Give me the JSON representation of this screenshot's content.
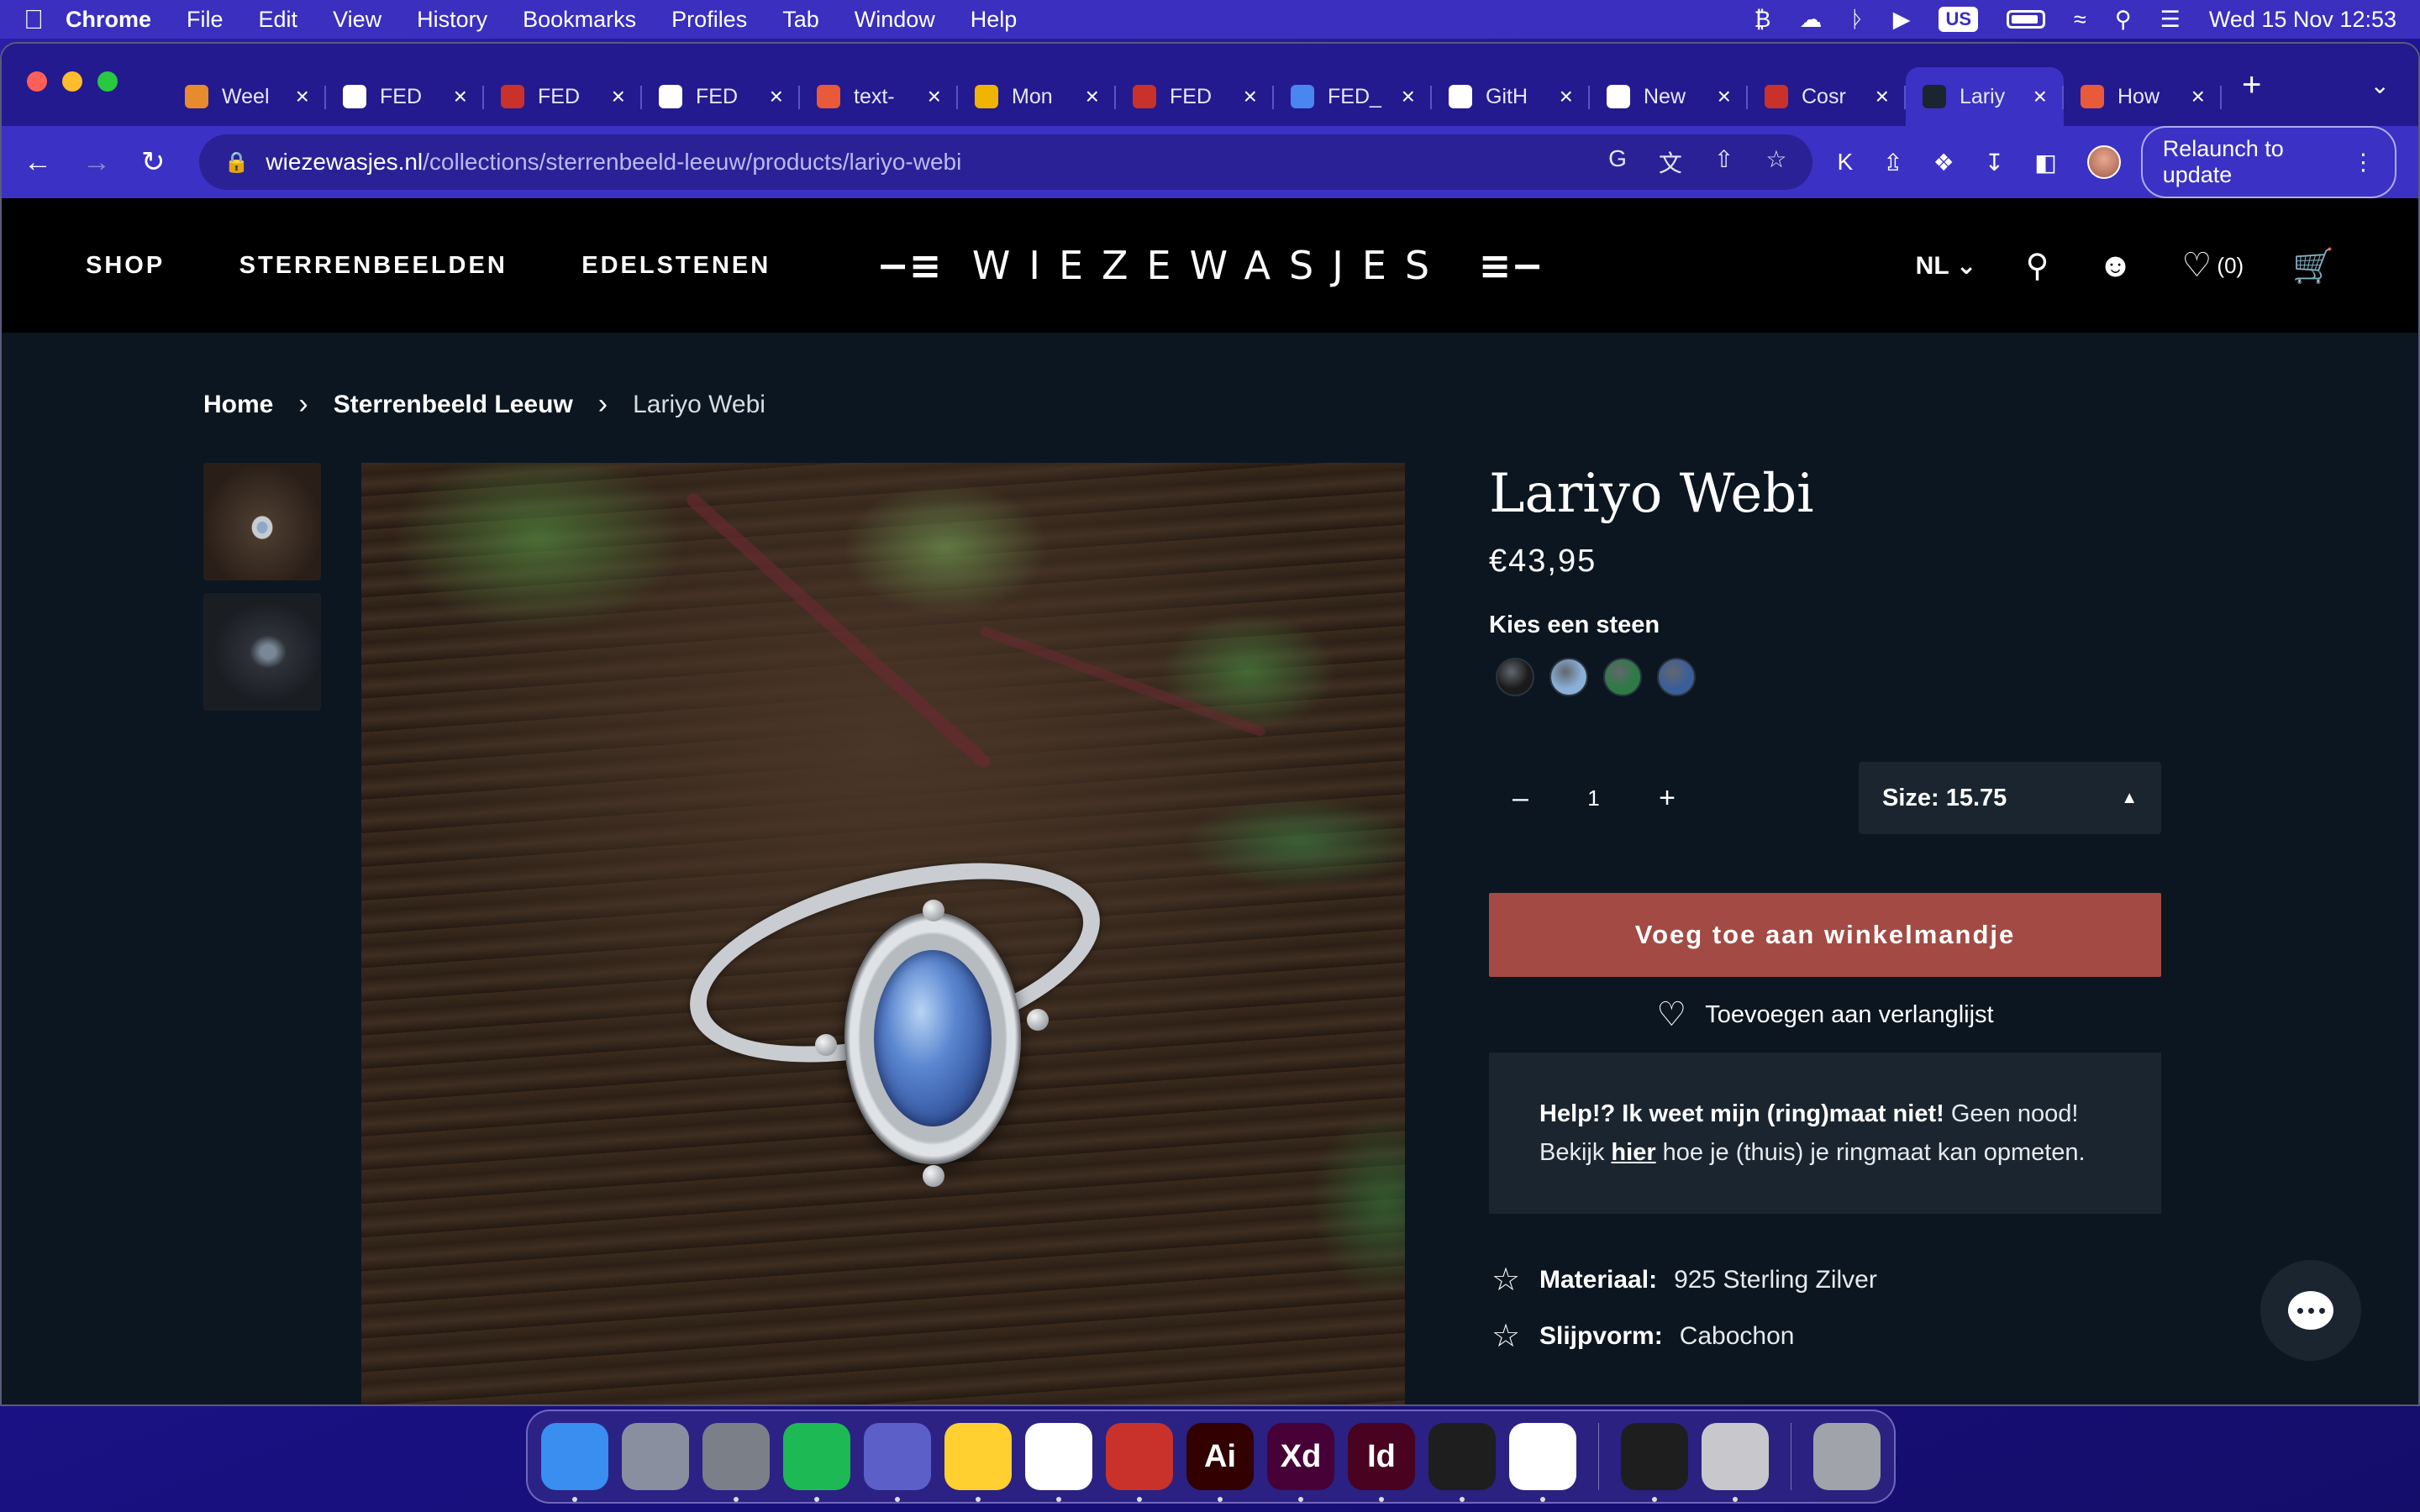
{
  "menubar": {
    "app": "Chrome",
    "items": [
      "File",
      "Edit",
      "View",
      "History",
      "Bookmarks",
      "Profiles",
      "Tab",
      "Window",
      "Help"
    ],
    "input_source": "US",
    "datetime": "Wed 15 Nov  12:53"
  },
  "browser": {
    "tabs": [
      {
        "label": "Weel",
        "icon": "bitcoin-icon",
        "color": "#e88a2e"
      },
      {
        "label": "FED",
        "icon": "codesandbox-icon",
        "color": "#ffffff"
      },
      {
        "label": "FED",
        "icon": "pdf-icon",
        "color": "#c8322a"
      },
      {
        "label": "FED",
        "icon": "codesandbox-icon",
        "color": "#ffffff"
      },
      {
        "label": "text-",
        "icon": "asterisk-icon",
        "color": "#e85a3a"
      },
      {
        "label": "Mon",
        "icon": "monday-icon",
        "color": "#f0b400"
      },
      {
        "label": "FED",
        "icon": "pdf-icon",
        "color": "#c8322a"
      },
      {
        "label": "FED_",
        "icon": "docs-icon",
        "color": "#4a86f0"
      },
      {
        "label": "GitH",
        "icon": "github-icon",
        "color": "#ffffff"
      },
      {
        "label": "New",
        "icon": "github-icon",
        "color": "#ffffff"
      },
      {
        "label": "Cosr",
        "icon": "cosmos-icon",
        "color": "#c8322a"
      },
      {
        "label": "Lariy",
        "icon": "star-icon",
        "color": "#1a2530",
        "active": true
      },
      {
        "label": "How",
        "icon": "asterisk-icon",
        "color": "#e85a3a"
      }
    ],
    "url_host": "wiezewasjes.nl",
    "url_path": "/collections/sterrenbeeld-leeuw/products/lariyo-webi",
    "relaunch_label": "Relaunch to update"
  },
  "site": {
    "nav": [
      "SHOP",
      "STERRENBEELDEN",
      "EDELSTENEN"
    ],
    "logo": "WIEZEWASJES",
    "language": "NL",
    "wishlist_count": "(0)"
  },
  "breadcrumb": {
    "home": "Home",
    "category": "Sterrenbeeld Leeuw",
    "current": "Lariyo Webi"
  },
  "product": {
    "title": "Lariyo Webi",
    "price": "€43,95",
    "stone_label": "Kies een steen",
    "stones": [
      {
        "name": "black-stone",
        "color": "#1a1a1a"
      },
      {
        "name": "blue-moonstone",
        "color": "#8ab0d8"
      },
      {
        "name": "malachite",
        "color": "#2e7a44"
      },
      {
        "name": "labradorite",
        "color": "#3a5e9a"
      }
    ],
    "quantity": "1",
    "size_label": "Size: 15.75",
    "add_to_cart": "Voeg toe aan winkelmandje",
    "wishlist_label": "Toevoegen aan verlanglijst",
    "help_bold": "Help!? Ik weet mijn (ring)maat niet!",
    "help_text_1": " Geen nood! Bekijk ",
    "help_link": "hier",
    "help_text_2": " hoe je (thuis) je ringmaat kan opmeten.",
    "specs": [
      {
        "key": "Materiaal:",
        "value": "925 Sterling Zilver"
      },
      {
        "key": "Slijpvorm:",
        "value": "Cabochon"
      }
    ]
  },
  "dock": [
    {
      "name": "finder-icon",
      "label": "",
      "color": "#3a8ef0"
    },
    {
      "name": "launchpad-icon",
      "label": "",
      "color": "#8a8fa0"
    },
    {
      "name": "system-settings-icon",
      "label": "",
      "color": "#7a7f88"
    },
    {
      "name": "spotify-icon",
      "label": "",
      "color": "#1db954"
    },
    {
      "name": "teams-icon",
      "label": "",
      "color": "#5b5fc7"
    },
    {
      "name": "miro-icon",
      "label": "",
      "color": "#ffd02f"
    },
    {
      "name": "chrome-icon",
      "label": "",
      "color": "#ffffff"
    },
    {
      "name": "acrobat-icon",
      "label": "",
      "color": "#c8322a"
    },
    {
      "name": "illustrator-icon",
      "label": "Ai",
      "color": "#330000"
    },
    {
      "name": "xd-icon",
      "label": "Xd",
      "color": "#470137"
    },
    {
      "name": "indesign-icon",
      "label": "Id",
      "color": "#49021f"
    },
    {
      "name": "figma-icon",
      "label": "",
      "color": "#1e1e1e"
    },
    {
      "name": "vscode-icon",
      "label": "",
      "color": "#ffffff"
    },
    {
      "name": "terminal-icon",
      "label": "",
      "color": "#1e1e1e"
    },
    {
      "name": "font-book-icon",
      "label": "",
      "color": "#c8c8cc"
    },
    {
      "name": "trash-icon",
      "label": "",
      "color": "#a0a4aa"
    }
  ]
}
